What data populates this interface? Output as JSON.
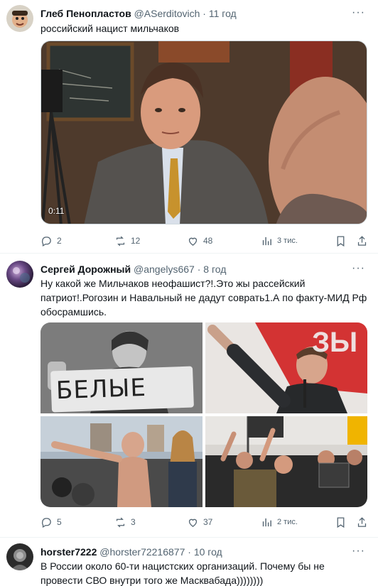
{
  "tweets": [
    {
      "author": "Глеб Пенопластов",
      "handle": "@ASerditovich",
      "dot": "·",
      "time": "11 год",
      "text": "российский нацист мильчаков",
      "video_duration": "0:11",
      "stats": {
        "replies": "2",
        "retweets": "12",
        "likes": "48",
        "views": "3 тис."
      }
    },
    {
      "author": "Сергей Дорожный",
      "handle": "@angelys667",
      "dot": "·",
      "time": "8 год",
      "text": "Ну какой же Мильчаков неофашист?!.Это жы рассейский патриот!.Рогозин и Навальный не дадут соврать1.А по факту-МИД Рф обосрамшись.",
      "photo1_sign": "БЕЛЫЕ",
      "photo2_sign": "ЗЫ",
      "stats": {
        "replies": "5",
        "retweets": "3",
        "likes": "37",
        "views": "2 тис."
      }
    },
    {
      "author": "horster7222",
      "handle": "@horster72216877",
      "dot": "·",
      "time": "10 год",
      "text": "В России около 60-ти нацистских организаций. Почему бы не провести СВО внутри того же Масквабада))))))))"
    }
  ]
}
